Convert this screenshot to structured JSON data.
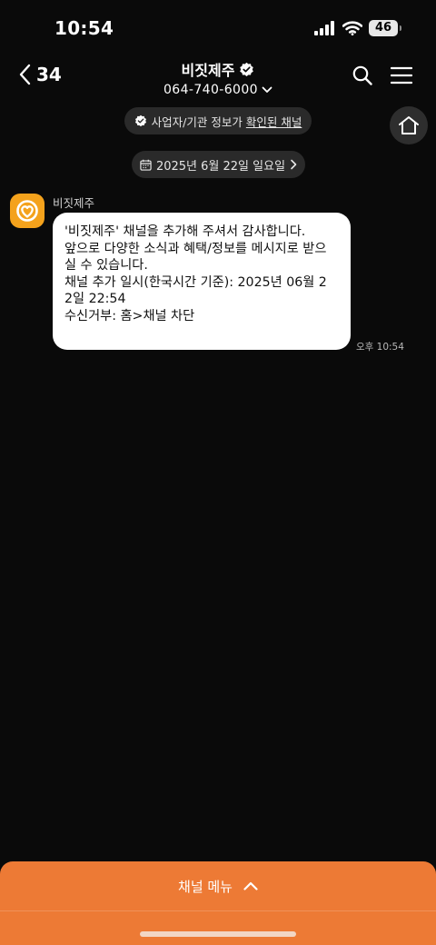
{
  "status_bar": {
    "time": "10:54",
    "battery": "46",
    "icons": [
      "cellular-signal-icon",
      "wifi-icon",
      "battery-icon"
    ]
  },
  "header": {
    "back_count": "34",
    "title": "비짓제주",
    "phone": "064-740-6000",
    "icons": [
      "chevron-left-icon",
      "verified-badge-icon",
      "chevron-down-icon",
      "search-icon",
      "hamburger-menu-icon"
    ]
  },
  "verified_notice": {
    "prefix": "사업자/기관 정보가 ",
    "link": "확인된 채널"
  },
  "date_divider": {
    "label": "2025년 6월 22일 일요일",
    "icons": [
      "calendar-icon",
      "chevron-right-icon"
    ]
  },
  "message": {
    "sender": "비짓제주",
    "lines": [
      "'비짓제주' 채널을 추가해 주셔서 감사합니다.",
      "앞으로 다양한 소식과 혜택/정보를 메시지로 받으",
      "실 수 있습니다.",
      "",
      "채널 추가 일시(한국시간 기준): 2025년 06월 2",
      "2일 22:54",
      "수신거부: 홈>채널 차단"
    ],
    "time": "오후 10:54"
  },
  "bottom_menu": {
    "label": "채널 메뉴",
    "icon": "chevron-up-icon"
  },
  "colors": {
    "background": "#0a0a0a",
    "pill": "#2a2a2a",
    "accent_orange": "#ed7a35",
    "avatar_yellow": "#f4a21c",
    "bubble": "#ffffff"
  }
}
